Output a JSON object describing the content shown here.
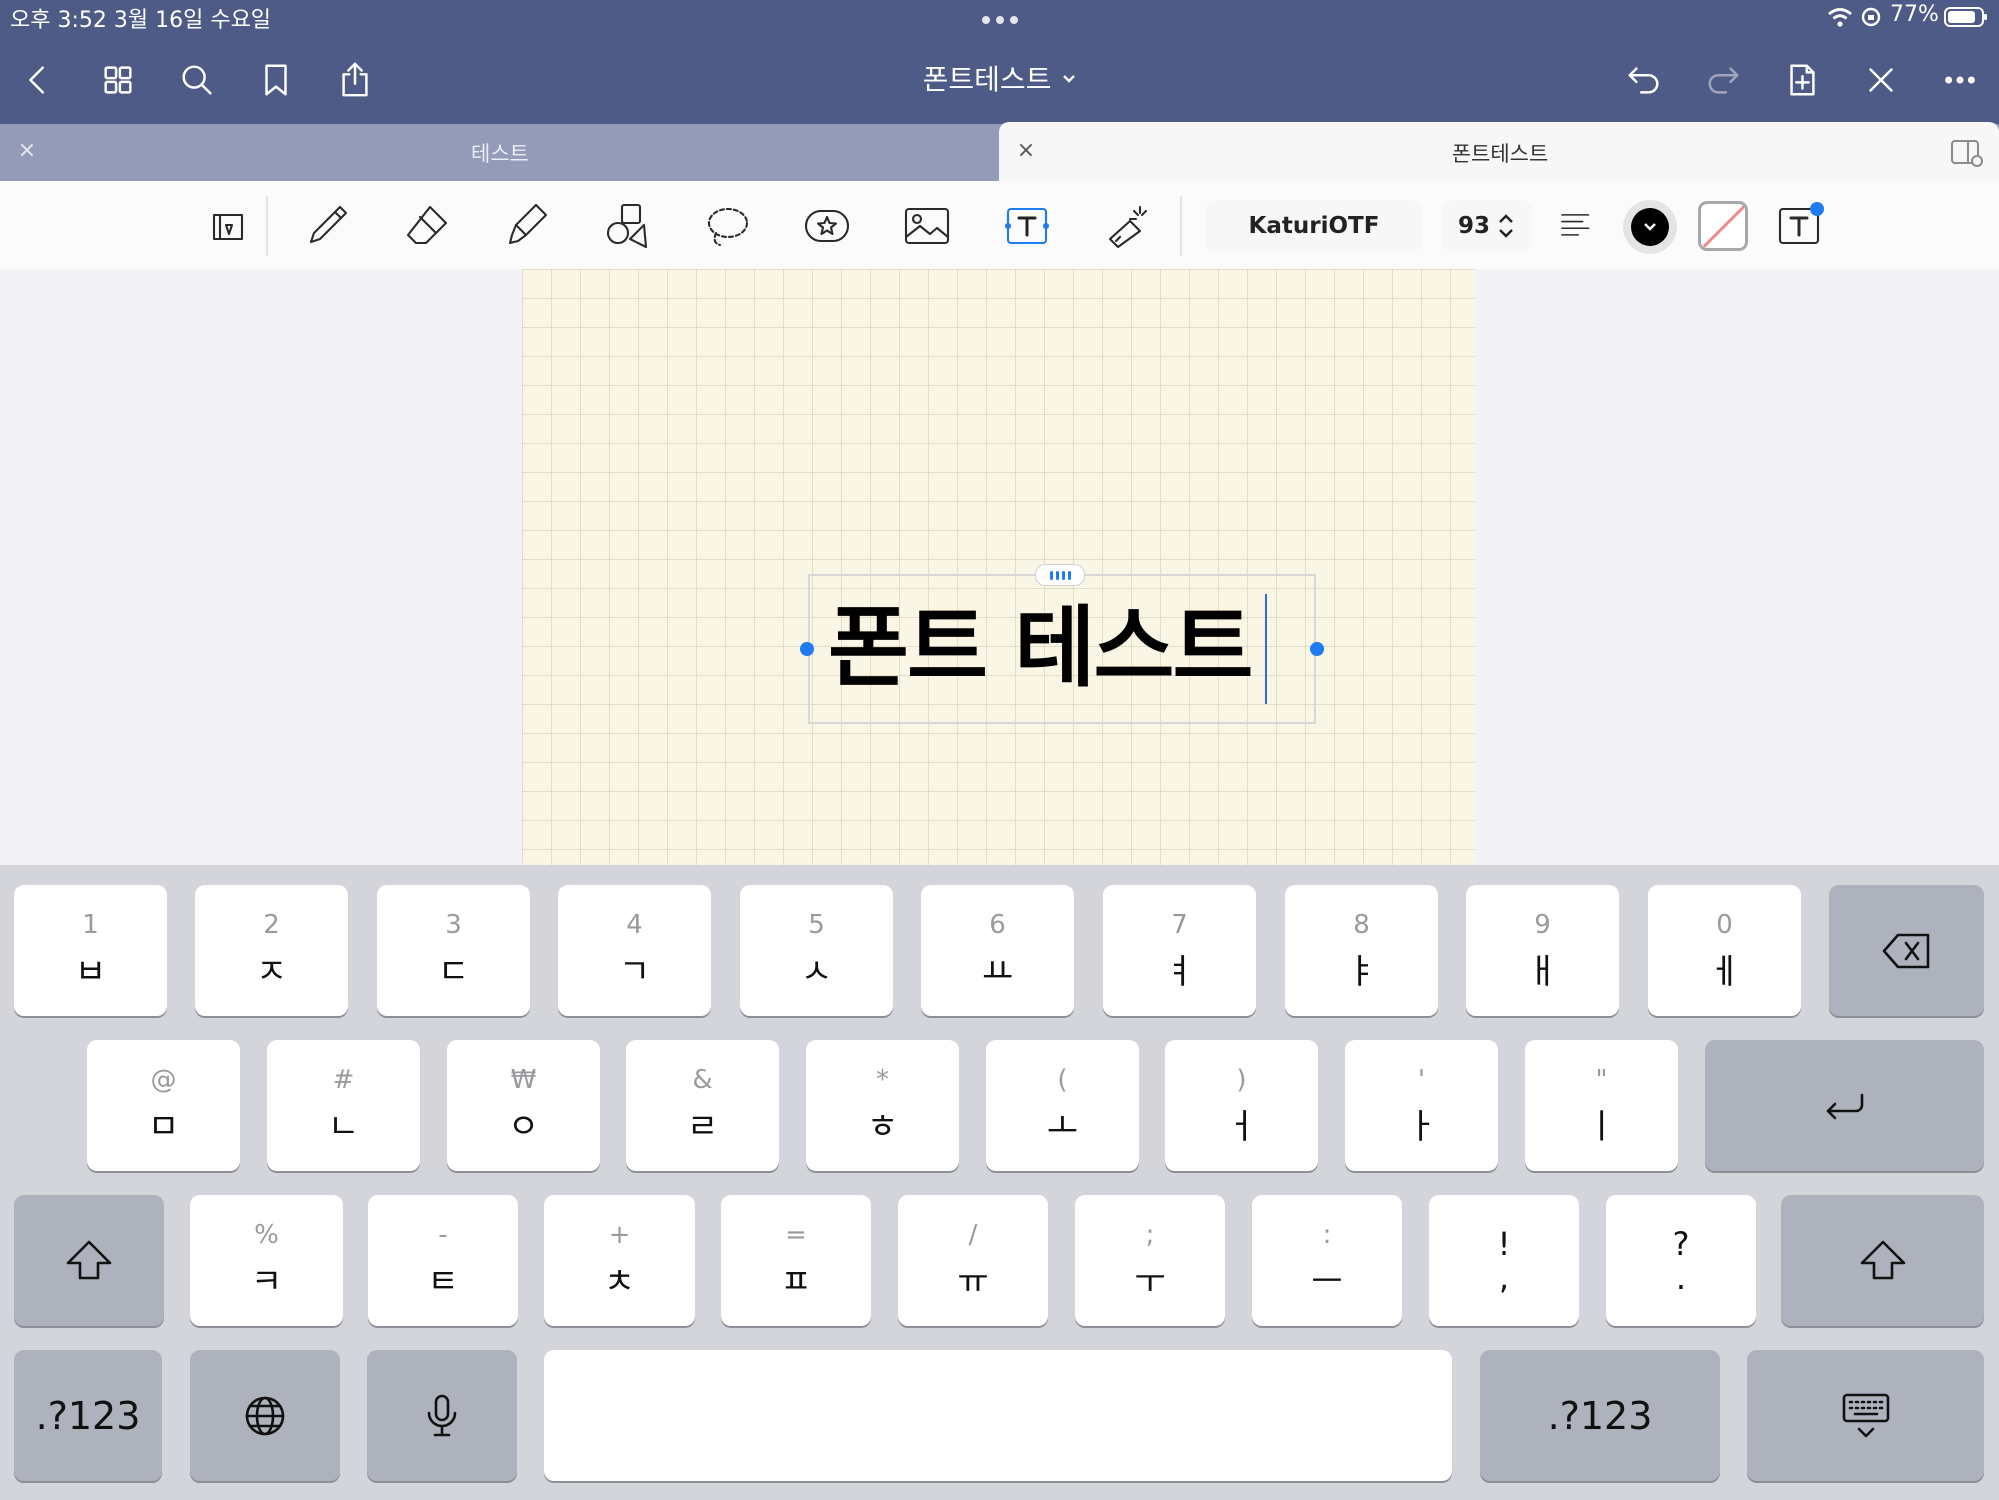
{
  "status_bar": {
    "time_date": "오후 3:52   3월 16일 수요일",
    "battery": "77%"
  },
  "nav": {
    "doc_title": "폰트테스트"
  },
  "tabs": [
    {
      "label": "테스트",
      "active": false,
      "close": "×"
    },
    {
      "label": "폰트테스트",
      "active": true,
      "close": "×"
    }
  ],
  "text_tool": {
    "font_name": "KaturiOTF",
    "font_size": "93",
    "text_color": "#000000"
  },
  "canvas": {
    "text_content": "폰트 테스트"
  },
  "keyboard": {
    "row1": [
      {
        "hint": "1",
        "main": "ㅂ"
      },
      {
        "hint": "2",
        "main": "ㅈ"
      },
      {
        "hint": "3",
        "main": "ㄷ"
      },
      {
        "hint": "4",
        "main": "ㄱ"
      },
      {
        "hint": "5",
        "main": "ㅅ"
      },
      {
        "hint": "6",
        "main": "ㅛ"
      },
      {
        "hint": "7",
        "main": "ㅕ"
      },
      {
        "hint": "8",
        "main": "ㅑ"
      },
      {
        "hint": "9",
        "main": "ㅐ"
      },
      {
        "hint": "0",
        "main": "ㅔ"
      }
    ],
    "row2": [
      {
        "hint": "@",
        "main": "ㅁ"
      },
      {
        "hint": "#",
        "main": "ㄴ"
      },
      {
        "hint": "₩",
        "main": "ㅇ"
      },
      {
        "hint": "&",
        "main": "ㄹ"
      },
      {
        "hint": "*",
        "main": "ㅎ"
      },
      {
        "hint": "(",
        "main": "ㅗ"
      },
      {
        "hint": ")",
        "main": "ㅓ"
      },
      {
        "hint": "'",
        "main": "ㅏ"
      },
      {
        "hint": "\"",
        "main": "ㅣ"
      }
    ],
    "row3": [
      {
        "hint": "%",
        "main": "ㅋ"
      },
      {
        "hint": "-",
        "main": "ㅌ"
      },
      {
        "hint": "+",
        "main": "ㅊ"
      },
      {
        "hint": "=",
        "main": "ㅍ"
      },
      {
        "hint": "/",
        "main": "ㅠ"
      },
      {
        "hint": ";",
        "main": "ㅜ"
      },
      {
        "hint": ":",
        "main": "ㅡ"
      }
    ],
    "row3_punct": [
      {
        "top": "!",
        "bottom": ","
      },
      {
        "top": "?",
        "bottom": "."
      }
    ],
    "numbers_label": ".?123"
  }
}
